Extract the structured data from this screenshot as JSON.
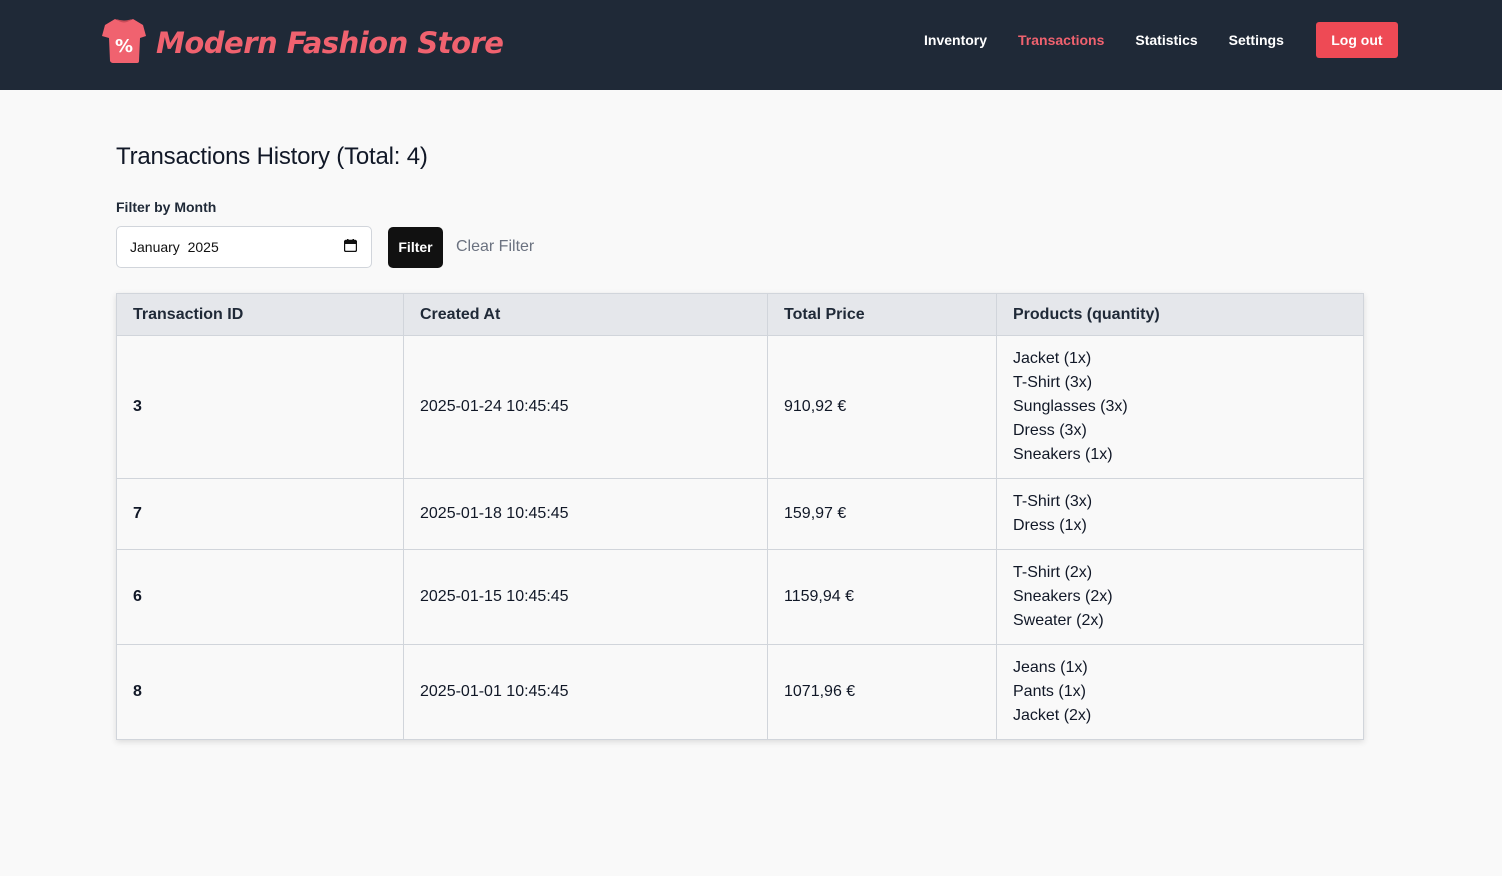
{
  "brand": {
    "name": "Modern Fashion Store",
    "logo_icon": "shirt-percent-icon",
    "accent": "#f0626f"
  },
  "nav": {
    "items": [
      {
        "label": "Inventory",
        "active": false
      },
      {
        "label": "Transactions",
        "active": true
      },
      {
        "label": "Statistics",
        "active": false
      },
      {
        "label": "Settings",
        "active": false
      }
    ],
    "logout_label": "Log out"
  },
  "page": {
    "title": "Transactions History (Total: 4)"
  },
  "filter": {
    "label": "Filter by Month",
    "month_value": "January  2025",
    "button_label": "Filter",
    "clear_label": "Clear Filter"
  },
  "table": {
    "headers": [
      "Transaction ID",
      "Created At",
      "Total Price",
      "Products (quantity)"
    ],
    "rows": [
      {
        "id": "3",
        "created_at": "2025-01-24 10:45:45",
        "total": "910,92 €",
        "products": [
          "Jacket (1x)",
          "T-Shirt (3x)",
          "Sunglasses (3x)",
          "Dress (3x)",
          "Sneakers (1x)"
        ]
      },
      {
        "id": "7",
        "created_at": "2025-01-18 10:45:45",
        "total": "159,97 €",
        "products": [
          "T-Shirt (3x)",
          "Dress (1x)"
        ]
      },
      {
        "id": "6",
        "created_at": "2025-01-15 10:45:45",
        "total": "1159,94 €",
        "products": [
          "T-Shirt (2x)",
          "Sneakers (2x)",
          "Sweater (2x)"
        ]
      },
      {
        "id": "8",
        "created_at": "2025-01-01 10:45:45",
        "total": "1071,96 €",
        "products": [
          "Jeans (1x)",
          "Pants (1x)",
          "Jacket (2x)"
        ]
      }
    ]
  }
}
